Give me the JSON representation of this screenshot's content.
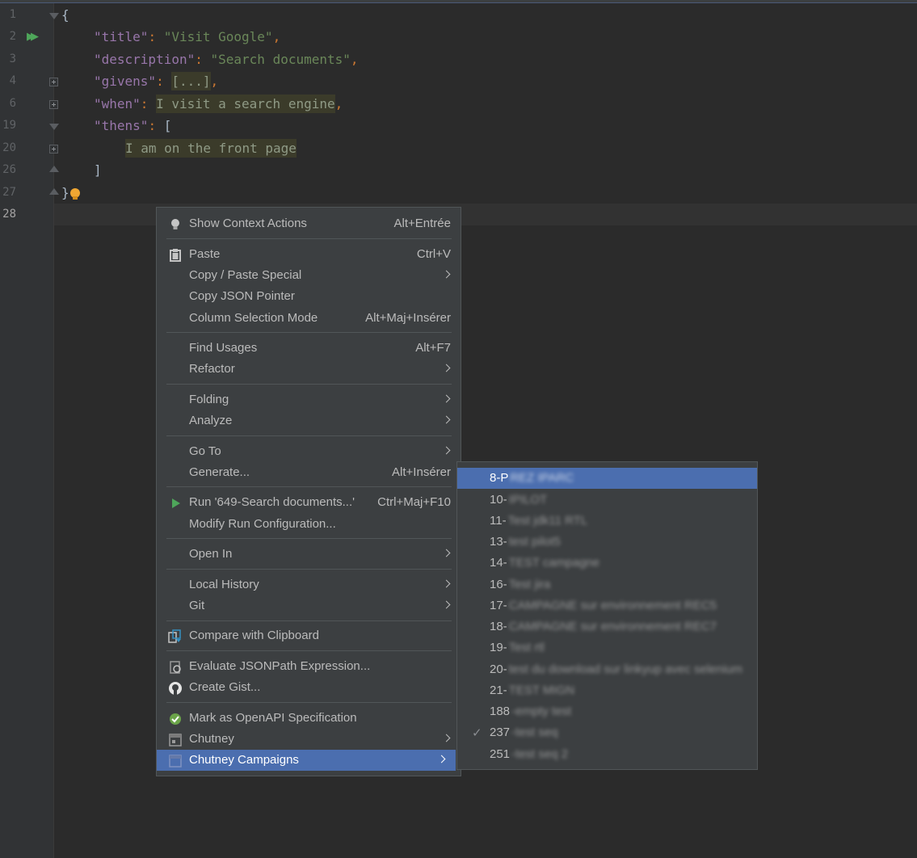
{
  "editor": {
    "line_numbers": [
      "1",
      "2",
      "3",
      "4",
      "6",
      "19",
      "20",
      "26",
      "27",
      "28"
    ],
    "lines": [
      {
        "open": "{"
      },
      {
        "key": "\"title\"",
        "sep": ": ",
        "val": "\"Visit Google\"",
        "end": ","
      },
      {
        "key": "\"description\"",
        "sep": ": ",
        "val": "\"Search documents\"",
        "end": ","
      },
      {
        "key": "\"givens\"",
        "sep": ": ",
        "folded": "[...]",
        "end": ","
      },
      {
        "key": "\"when\"",
        "sep": ": ",
        "hl": "I visit a search engine",
        "end": ","
      },
      {
        "key": "\"thens\"",
        "sep": ": ",
        "open": "["
      },
      {
        "hl": "I am on the front page"
      },
      {
        "close": "]"
      },
      {
        "close": "}"
      }
    ]
  },
  "context_menu": {
    "items": [
      {
        "label": "Show Context Actions",
        "shortcut": "Alt+Entrée",
        "icon": "lightbulb-icon"
      },
      {
        "label": "Paste",
        "shortcut": "Ctrl+V",
        "icon": "clipboard-icon"
      },
      {
        "label": "Copy / Paste Special",
        "submenu": true
      },
      {
        "label": "Copy JSON Pointer"
      },
      {
        "label": "Column Selection Mode",
        "shortcut": "Alt+Maj+Insérer"
      },
      {
        "label": "Find Usages",
        "shortcut": "Alt+F7"
      },
      {
        "label": "Refactor",
        "submenu": true
      },
      {
        "label": "Folding",
        "submenu": true
      },
      {
        "label": "Analyze",
        "submenu": true
      },
      {
        "label": "Go To",
        "submenu": true
      },
      {
        "label": "Generate...",
        "shortcut": "Alt+Insérer"
      },
      {
        "label": "Run '649-Search documents...'",
        "shortcut": "Ctrl+Maj+F10",
        "icon": "run-icon"
      },
      {
        "label": "Modify Run Configuration..."
      },
      {
        "label": "Open In",
        "submenu": true
      },
      {
        "label": "Local History",
        "submenu": true
      },
      {
        "label": "Git",
        "submenu": true
      },
      {
        "label": "Compare with Clipboard",
        "icon": "compare-icon"
      },
      {
        "label": "Evaluate JSONPath Expression...",
        "icon": "jsonpath-icon"
      },
      {
        "label": "Create Gist...",
        "icon": "github-icon"
      },
      {
        "label": "Mark as OpenAPI Specification",
        "icon": "openapi-icon"
      },
      {
        "label": "Chutney",
        "submenu": true,
        "icon": "chutney-icon"
      },
      {
        "label": "Chutney Campaigns",
        "submenu": true,
        "icon": "chutney-campaigns-icon",
        "selected": true
      }
    ]
  },
  "campaigns_submenu": {
    "items": [
      {
        "num": "8-P",
        "name": "REZ IPARC",
        "selected": true
      },
      {
        "num": "10-",
        "name": "IPILOT"
      },
      {
        "num": "11-",
        "name": "Test jdk11 RTL"
      },
      {
        "num": "13-",
        "name": "test pilot5"
      },
      {
        "num": "14-",
        "name": "TEST campagne"
      },
      {
        "num": "16-",
        "name": "Test jira"
      },
      {
        "num": "17-",
        "name": "CAMPAGNE sur environnement REC5"
      },
      {
        "num": "18-",
        "name": "CAMPAGNE sur environnement REC7"
      },
      {
        "num": "19-",
        "name": "Test rtl"
      },
      {
        "num": "20-",
        "name": "test du download sur linkyup avec selenium"
      },
      {
        "num": "21-",
        "name": "TEST MIGN"
      },
      {
        "num": "188",
        "name": "-empty test"
      },
      {
        "num": "237",
        "name": "-test seq",
        "checked": true
      },
      {
        "num": "251",
        "name": "-test seq 2"
      }
    ]
  }
}
